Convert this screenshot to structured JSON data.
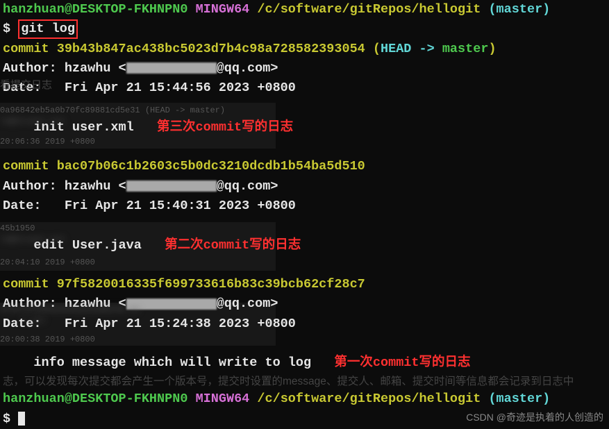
{
  "prompt1": {
    "user": "hanzhuan@DESKTOP-FKHNPN0",
    "env": "MINGW64",
    "path": "/c/software/gitRepos/hellogit",
    "branch": "(master)",
    "sigil": "$",
    "command": "git log"
  },
  "commits": [
    {
      "hash_line": "commit 39b43b847ac438bc5023d7b4c98a728582393054 ",
      "head_open": "(",
      "head_text": "HEAD -> ",
      "head_master": "master",
      "head_close": ")",
      "author_prefix": "Author: hzawhu <",
      "author_domain": "@qq.com>",
      "date_line": "Date:   Fri Apr 21 15:44:56 2023 +0800",
      "message": "    init user.xml",
      "annotation": "第三次commit写的日志"
    },
    {
      "hash_line": "commit bac07b06c1b2603c5b0dc3210dcdb1b54ba5d510",
      "author_prefix": "Author: hzawhu <",
      "author_domain": "@qq.com>",
      "date_line": "Date:   Fri Apr 21 15:40:31 2023 +0800",
      "message": "    edit User.java",
      "annotation": "第二次commit写的日志"
    },
    {
      "hash_line": "commit 97f5820016335f699733616b83c39bcb62cf28c7",
      "author_prefix": "Author: hzawhu <",
      "author_domain": "@qq.com>",
      "date_line": "Date:   Fri Apr 21 15:24:38 2023 +0800",
      "message": "    info message which will write to log",
      "annotation": "第一次commit写的日志"
    }
  ],
  "bgtext": {
    "top_caption": "看提交日志",
    "line1a": "0a96842eb5a0b70fc89881cd5e31 (HEAD -> master)",
    "line1b": "lo@itcast.cn>",
    "line1c": "20:06:36 2019 +0800",
    "line2a": "45b1950",
    "line2b": "lo@itcast.cn>",
    "line2c": "20:04:10 2019 +0800",
    "line3a": "8f347bf56bb29948101dd624b.oc",
    "line3b": "t.cn>",
    "line3c": "20:00:38 2019 +0800",
    "bottom_caption": "志，可以发现每次提交都会产生一个版本号，提交时设置的message、提交人、邮箱、提交时间等信息都会记录到日志中"
  },
  "prompt2": {
    "user": "hanzhuan@DESKTOP-FKHNPN0",
    "env": "MINGW64",
    "path": "/c/software/gitRepos/hellogit",
    "branch": "(master)",
    "sigil": "$"
  },
  "watermark": "CSDN @奇迹是执着的人创造的"
}
